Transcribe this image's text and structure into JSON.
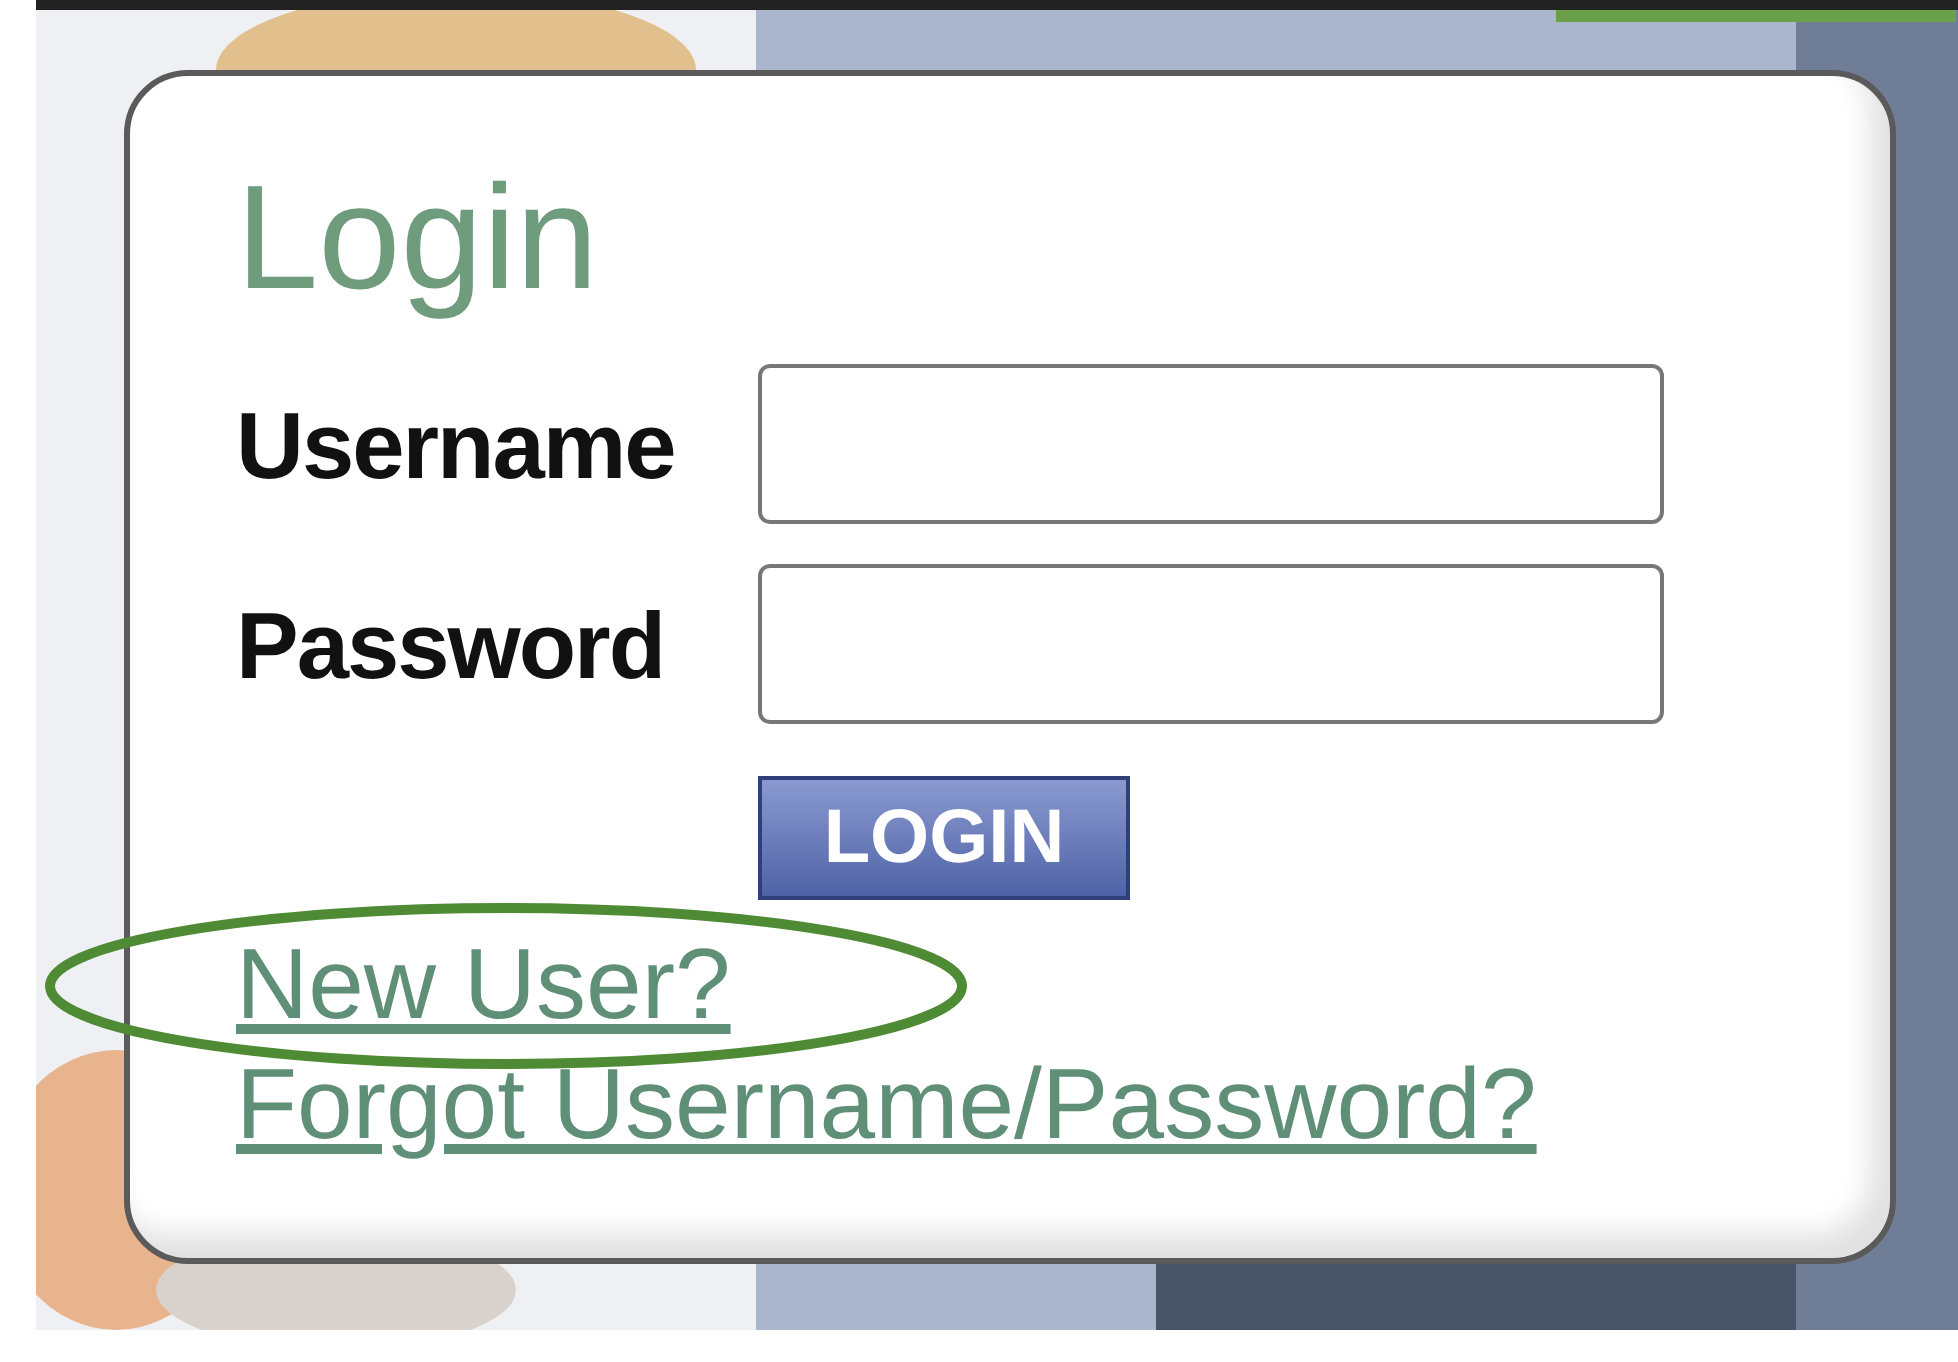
{
  "login_box": {
    "title": "Login",
    "fields": [
      {
        "label": "Username"
      },
      {
        "label": "Password"
      }
    ],
    "button": "LOGIN",
    "links": [
      {
        "label": "New User?",
        "highlighted": true
      },
      {
        "label": "Forgot Username/Password?",
        "highlighted": false
      }
    ]
  }
}
